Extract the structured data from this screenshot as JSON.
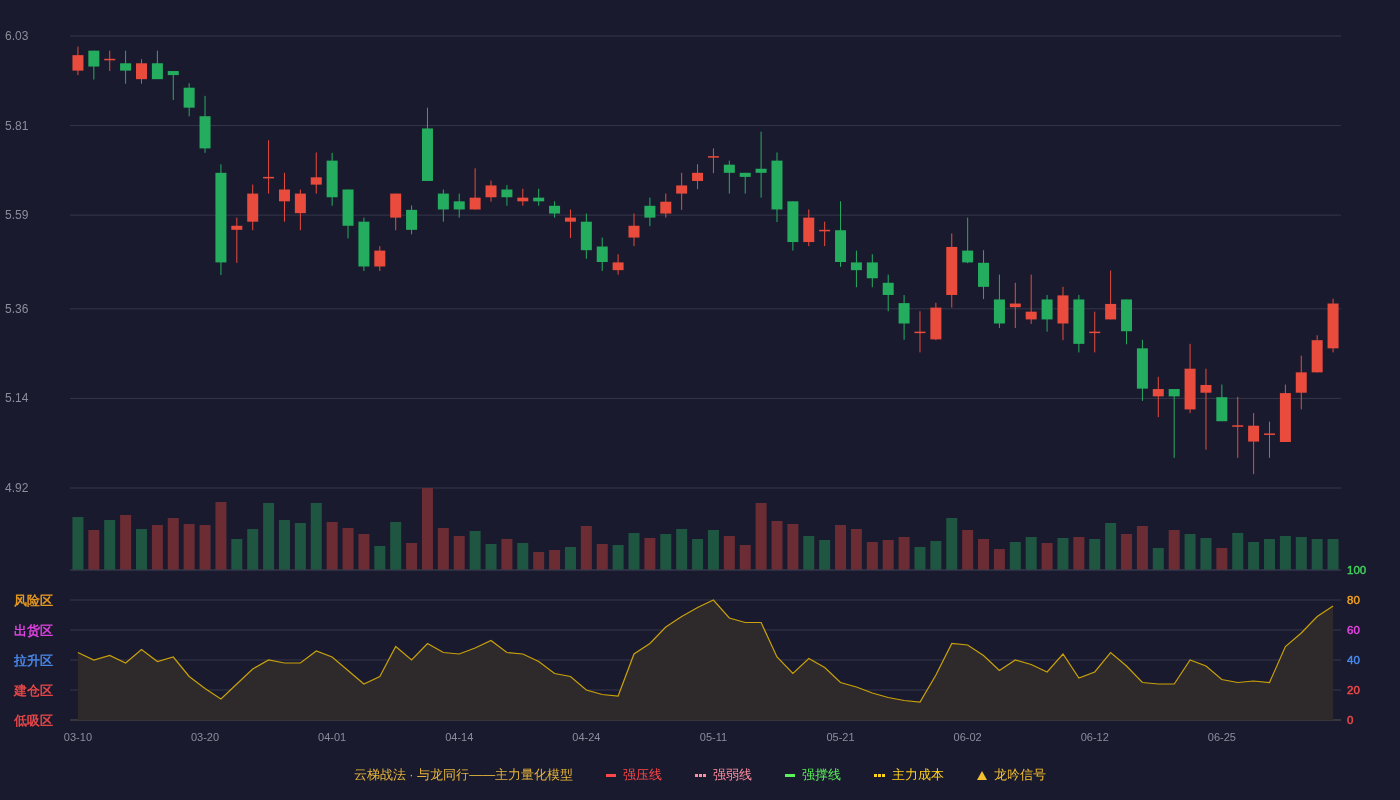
{
  "price_chart": {
    "chart_data": {
      "type": "candlestick",
      "grid": true,
      "ylim": [
        4.92,
        6.03
      ],
      "yticks": [
        6.03,
        5.81,
        5.59,
        5.36,
        5.14,
        4.92
      ],
      "categories": [
        null,
        null,
        null,
        null,
        null,
        null,
        null,
        null,
        null,
        null,
        null,
        null,
        null,
        null,
        null,
        null,
        null,
        null,
        null,
        null,
        null,
        null,
        null,
        null,
        null,
        null,
        null,
        null,
        null,
        null,
        null,
        null,
        null,
        null,
        null,
        null,
        null,
        null,
        null,
        null,
        null,
        null,
        null,
        null,
        null,
        null,
        null,
        null,
        null,
        null,
        null,
        null,
        null,
        null,
        null,
        null,
        null,
        null,
        null,
        null,
        null,
        null,
        null,
        null,
        null,
        null,
        null,
        null,
        null,
        null,
        null,
        null,
        null,
        null,
        null,
        null,
        null,
        null,
        null,
        null
      ],
      "ohlc": [
        [
          5.945,
          6.004,
          5.934,
          5.983
        ],
        [
          5.994,
          5.994,
          5.923,
          5.955
        ],
        [
          5.972,
          5.994,
          5.944,
          5.974
        ],
        [
          5.963,
          5.994,
          5.913,
          5.945
        ],
        [
          5.924,
          5.973,
          5.913,
          5.963
        ],
        [
          5.963,
          5.994,
          5.924,
          5.924
        ],
        [
          5.944,
          5.944,
          5.873,
          5.934
        ],
        [
          5.903,
          5.914,
          5.833,
          5.854
        ],
        [
          5.833,
          5.883,
          5.743,
          5.754
        ],
        [
          5.694,
          5.715,
          5.443,
          5.474
        ],
        [
          5.554,
          5.584,
          5.473,
          5.564
        ],
        [
          5.574,
          5.665,
          5.553,
          5.643
        ],
        [
          5.682,
          5.774,
          5.643,
          5.684
        ],
        [
          5.624,
          5.694,
          5.574,
          5.653
        ],
        [
          5.595,
          5.653,
          5.553,
          5.643
        ],
        [
          5.665,
          5.744,
          5.643,
          5.683
        ],
        [
          5.724,
          5.743,
          5.613,
          5.634
        ],
        [
          5.653,
          5.653,
          5.533,
          5.564
        ],
        [
          5.574,
          5.584,
          5.453,
          5.464
        ],
        [
          5.464,
          5.514,
          5.453,
          5.503
        ],
        [
          5.584,
          5.643,
          5.553,
          5.643
        ],
        [
          5.603,
          5.614,
          5.543,
          5.554
        ],
        [
          5.803,
          5.854,
          5.674,
          5.674
        ],
        [
          5.643,
          5.653,
          5.574,
          5.604
        ],
        [
          5.624,
          5.643,
          5.584,
          5.604
        ],
        [
          5.604,
          5.705,
          5.604,
          5.633
        ],
        [
          5.634,
          5.675,
          5.623,
          5.663
        ],
        [
          5.653,
          5.664,
          5.613,
          5.634
        ],
        [
          5.624,
          5.655,
          5.613,
          5.633
        ],
        [
          5.633,
          5.655,
          5.613,
          5.624
        ],
        [
          5.613,
          5.624,
          5.584,
          5.594
        ],
        [
          5.574,
          5.604,
          5.534,
          5.584
        ],
        [
          5.574,
          5.594,
          5.483,
          5.504
        ],
        [
          5.513,
          5.535,
          5.453,
          5.475
        ],
        [
          5.455,
          5.494,
          5.444,
          5.474
        ],
        [
          5.535,
          5.594,
          5.514,
          5.564
        ],
        [
          5.613,
          5.633,
          5.563,
          5.584
        ],
        [
          5.594,
          5.643,
          5.584,
          5.623
        ],
        [
          5.643,
          5.694,
          5.603,
          5.663
        ],
        [
          5.674,
          5.715,
          5.654,
          5.694
        ],
        [
          5.733,
          5.754,
          5.693,
          5.735
        ],
        [
          5.714,
          5.724,
          5.643,
          5.694
        ],
        [
          5.694,
          5.694,
          5.643,
          5.684
        ],
        [
          5.704,
          5.795,
          5.633,
          5.694
        ],
        [
          5.724,
          5.744,
          5.573,
          5.604
        ],
        [
          5.624,
          5.624,
          5.503,
          5.524
        ],
        [
          5.524,
          5.604,
          5.514,
          5.584
        ],
        [
          5.552,
          5.574,
          5.514,
          5.554
        ],
        [
          5.553,
          5.624,
          5.463,
          5.475
        ],
        [
          5.474,
          5.503,
          5.413,
          5.455
        ],
        [
          5.474,
          5.494,
          5.413,
          5.435
        ],
        [
          5.424,
          5.444,
          5.354,
          5.394
        ],
        [
          5.374,
          5.394,
          5.284,
          5.324
        ],
        [
          5.302,
          5.354,
          5.253,
          5.304
        ],
        [
          5.285,
          5.375,
          5.283,
          5.363
        ],
        [
          5.394,
          5.545,
          5.363,
          5.512
        ],
        [
          5.503,
          5.584,
          5.472,
          5.474
        ],
        [
          5.473,
          5.504,
          5.384,
          5.414
        ],
        [
          5.383,
          5.444,
          5.313,
          5.324
        ],
        [
          5.364,
          5.424,
          5.313,
          5.373
        ],
        [
          5.334,
          5.444,
          5.323,
          5.353
        ],
        [
          5.383,
          5.394,
          5.304,
          5.334
        ],
        [
          5.324,
          5.414,
          5.283,
          5.393
        ],
        [
          5.383,
          5.394,
          5.253,
          5.274
        ],
        [
          5.302,
          5.353,
          5.253,
          5.304
        ],
        [
          5.334,
          5.454,
          5.334,
          5.372
        ],
        [
          5.383,
          5.383,
          5.273,
          5.305
        ],
        [
          5.263,
          5.284,
          5.134,
          5.164
        ],
        [
          5.145,
          5.193,
          5.094,
          5.163
        ],
        [
          5.163,
          5.163,
          4.994,
          5.145
        ],
        [
          5.113,
          5.274,
          5.104,
          5.213
        ],
        [
          5.154,
          5.213,
          5.014,
          5.173
        ],
        [
          5.143,
          5.174,
          5.084,
          5.084
        ],
        [
          5.072,
          5.144,
          4.994,
          5.074
        ],
        [
          5.034,
          5.104,
          4.954,
          5.073
        ],
        [
          5.052,
          5.083,
          4.994,
          5.054
        ],
        [
          5.033,
          5.174,
          5.033,
          5.153
        ],
        [
          5.154,
          5.245,
          5.113,
          5.204
        ],
        [
          5.204,
          5.295,
          5.204,
          5.283
        ],
        [
          5.263,
          5.385,
          5.253,
          5.373
        ]
      ]
    }
  },
  "indicator": {
    "zone_labels": [
      {
        "text": "风险区",
        "color": "#f0a020"
      },
      {
        "text": "出货区",
        "color": "#e445e4"
      },
      {
        "text": "拉升区",
        "color": "#4a8cf0"
      },
      {
        "text": "建仓区",
        "color": "#f04a4a"
      },
      {
        "text": "低吸区",
        "color": "#f04a4a"
      }
    ],
    "tick_colors": [
      {
        "color": "#3fd05a"
      },
      {
        "color": "#f0a020"
      },
      {
        "color": "#e445e4"
      },
      {
        "color": "#4a8cf0"
      },
      {
        "color": "#f04a4a"
      },
      {
        "color": "#f04a4a"
      }
    ],
    "chart_data": {
      "type": "area",
      "grid": true,
      "ylim": [
        0,
        100
      ],
      "yticks": [
        100,
        80,
        60,
        40,
        20,
        0
      ],
      "categories": [
        "03-10",
        null,
        null,
        null,
        null,
        null,
        null,
        null,
        "03-20",
        null,
        null,
        null,
        null,
        null,
        null,
        null,
        "04-01",
        null,
        null,
        null,
        null,
        null,
        null,
        null,
        "04-14",
        null,
        null,
        null,
        null,
        null,
        null,
        null,
        "04-24",
        null,
        null,
        null,
        null,
        null,
        null,
        null,
        "05-11",
        null,
        null,
        null,
        null,
        null,
        null,
        null,
        "05-21",
        null,
        null,
        null,
        null,
        null,
        null,
        null,
        "06-02",
        null,
        null,
        null,
        null,
        null,
        null,
        null,
        "06-12",
        null,
        null,
        null,
        null,
        null,
        null,
        null,
        "06-25",
        null,
        null,
        null,
        null,
        null,
        null,
        null
      ],
      "series": [
        {
          "color": "#c9a10a",
          "values": [
            45,
            40,
            43,
            38,
            47,
            39,
            42,
            29,
            21,
            14,
            24,
            34,
            40,
            38,
            38,
            46,
            42,
            33,
            24,
            29,
            49,
            40,
            51,
            45,
            44,
            48,
            53,
            45,
            44,
            39,
            31,
            29,
            20,
            17,
            16,
            44,
            51,
            62,
            69,
            75,
            80,
            68,
            65,
            65,
            42,
            31,
            41,
            35,
            25,
            22,
            18,
            15,
            13,
            12,
            30,
            51,
            50,
            43,
            33,
            40,
            37,
            32,
            44,
            28,
            32,
            45,
            36,
            25,
            24,
            24,
            40,
            36,
            27,
            25,
            26,
            25,
            49,
            58,
            69,
            76
          ]
        }
      ]
    }
  },
  "legend": {
    "title": "云梯战法 · 与龙同行——主力量化模型",
    "items": [
      {
        "kind": "solid",
        "label": "强压线",
        "color": "#ff4747"
      },
      {
        "kind": "dashed",
        "label": "强弱线",
        "color": "#ff8fa0"
      },
      {
        "kind": "solid",
        "label": "强撑线",
        "color": "#5cf25c"
      },
      {
        "kind": "dashed",
        "label": "主力成本",
        "color": "#ffd21a"
      },
      {
        "kind": "triangle",
        "label": "龙吟信号",
        "color": "#f5c030"
      }
    ]
  }
}
